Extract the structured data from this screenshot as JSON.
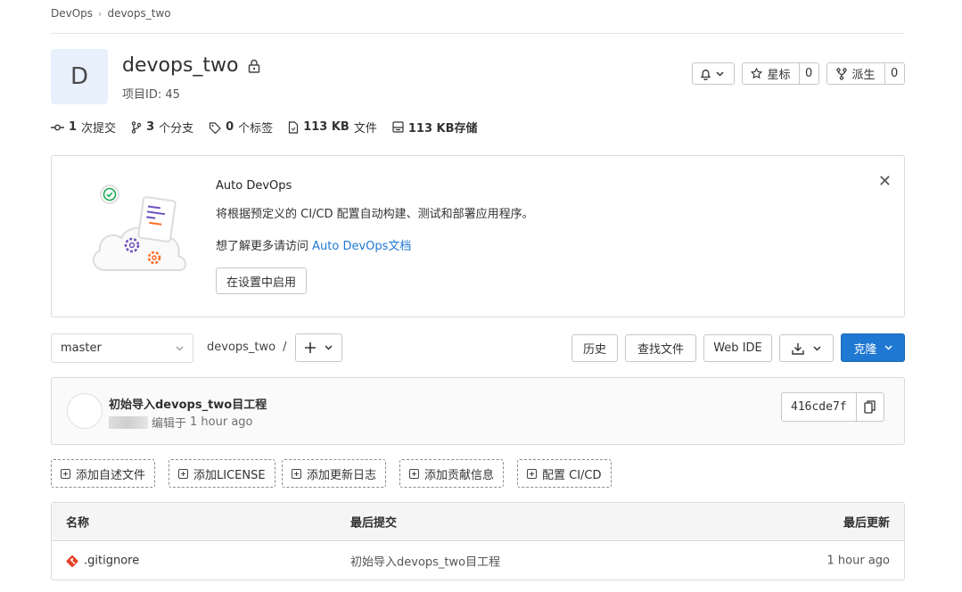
{
  "breadcrumb": {
    "group": "DevOps",
    "project": "devops_two"
  },
  "project": {
    "avatar_letter": "D",
    "name": "devops_two",
    "id_text": "项目ID: 45"
  },
  "header_actions": {
    "star_label": "星标",
    "star_count": "0",
    "fork_label": "派生",
    "fork_count": "0"
  },
  "stats": {
    "commits_num": "1",
    "commits_label": "次提交",
    "branches_num": "3",
    "branches_label": "个分支",
    "tags_num": "0",
    "tags_label": "个标签",
    "files_num": "113 KB",
    "files_label": "文件",
    "storage_num": "113 KB",
    "storage_label": "存储"
  },
  "auto_devops": {
    "title": "Auto DevOps",
    "description": "将根据预定义的 CI/CD 配置自动构建、测试和部署应用程序。",
    "more_prefix": "想了解更多请访问",
    "more_link": "Auto DevOps文档",
    "enable_button": "在设置中启用"
  },
  "repo_toolbar": {
    "branch": "master",
    "path_root": "devops_two",
    "path_sep": "/",
    "history": "历史",
    "find_file": "查找文件",
    "web_ide": "Web IDE",
    "clone": "克隆"
  },
  "last_commit": {
    "title": "初始导入devops_two目工程",
    "edited_label": "编辑于",
    "time": "1 hour ago",
    "sha": "416cde7f"
  },
  "quick_actions": [
    "添加自述文件",
    "添加LICENSE",
    "添加更新日志",
    "添加贡献信息",
    "配置 CI/CD"
  ],
  "file_table": {
    "headers": {
      "name": "名称",
      "last_commit": "最后提交",
      "last_update": "最后更新"
    },
    "rows": [
      {
        "name": ".gitignore",
        "commit": "初始导入devops_two目工程",
        "updated": "1 hour ago"
      }
    ]
  },
  "colors": {
    "primary": "#1f78d1",
    "link": "#1f78d1",
    "git_icon": "#e24329"
  }
}
